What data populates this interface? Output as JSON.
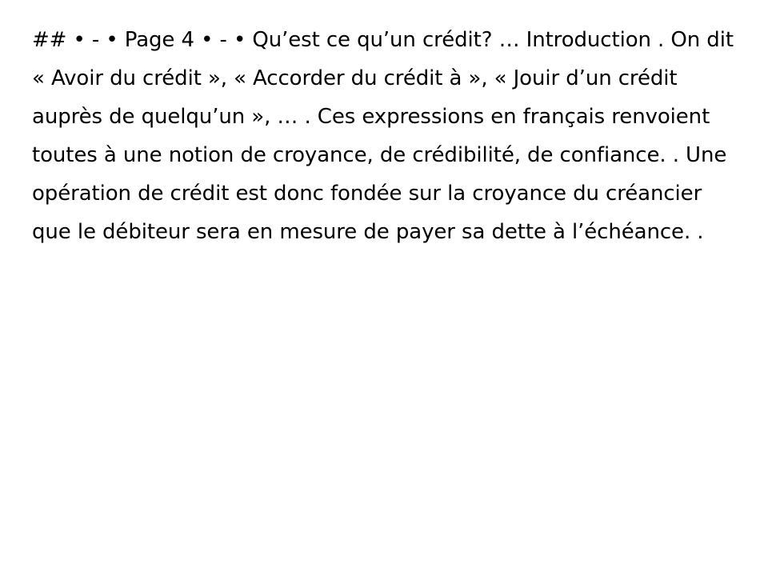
{
  "slide": {
    "text": "## • - • Page 4 • - • Qu’est ce qu’un crédit? … Introduction . On dit « Avoir du crédit », « Accorder du crédit à », « Jouir d’un crédit auprès de quelqu’un », … . Ces expressions en français renvoient toutes à une notion de croyance, de crédibilité, de confiance. . Une opération de crédit est donc fondée sur la croyance du créancier que le débiteur sera en mesure de payer sa dette à l’échéance. ."
  }
}
